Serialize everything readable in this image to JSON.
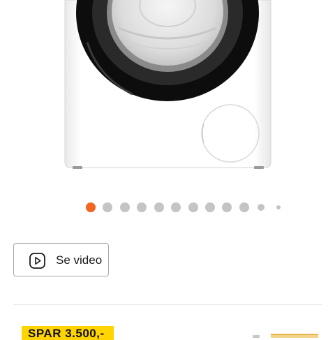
{
  "product": {
    "image_icon": "washing-machine-icon"
  },
  "carousel": {
    "total": 12,
    "active_index": 0,
    "active_color": "#f26522",
    "inactive_color": "#c4c4c4"
  },
  "video_button": {
    "label": "Se video",
    "icon": "play-icon"
  },
  "offer": {
    "save_label": "SPAR 3.500,-",
    "badge_color": "#ffd400"
  }
}
